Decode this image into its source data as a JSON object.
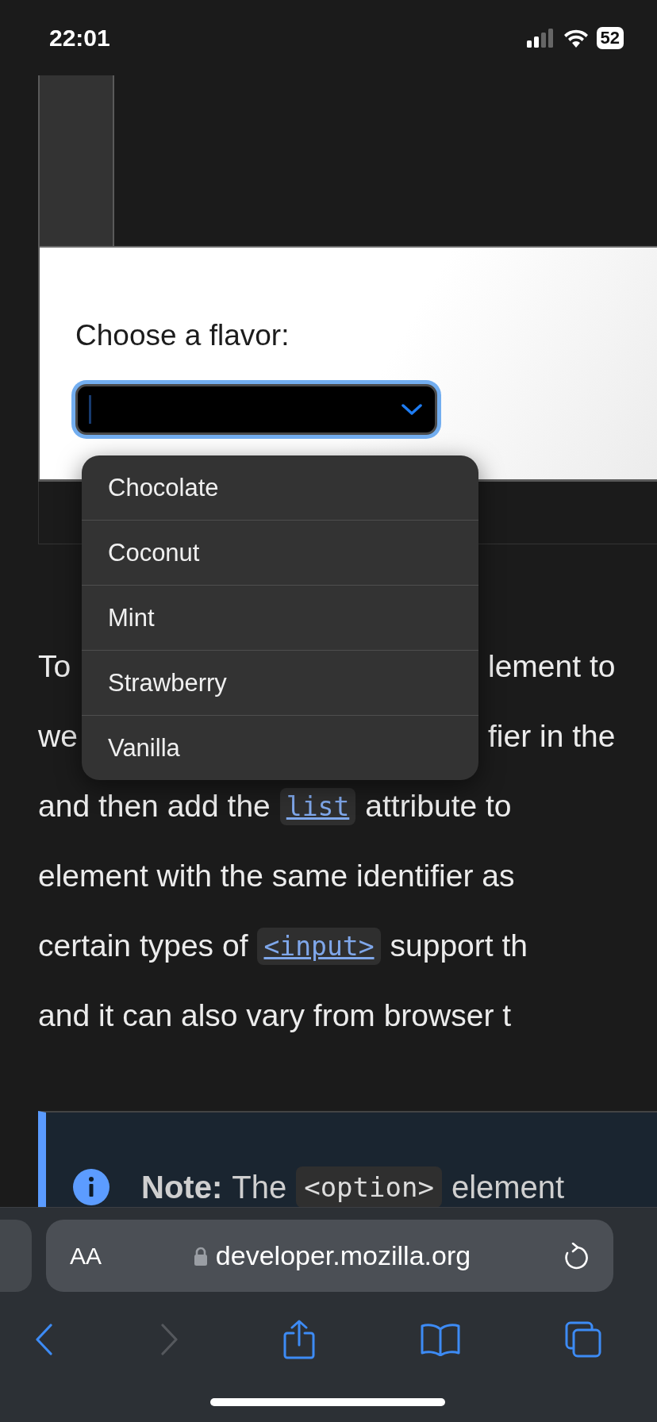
{
  "status_bar": {
    "time": "22:01",
    "battery": "52"
  },
  "demo": {
    "label": "Choose a flavor:",
    "focused": true,
    "open": true,
    "options": [
      {
        "label": "Chocolate"
      },
      {
        "label": "Coconut"
      },
      {
        "label": "Mint"
      },
      {
        "label": "Strawberry"
      },
      {
        "label": "Vanilla"
      }
    ]
  },
  "paragraph": [
    {
      "kind": "split",
      "left": "To",
      "right": "lement to"
    },
    {
      "kind": "split",
      "left": "we",
      "right": "fier in the"
    },
    {
      "kind": "full",
      "segments": [
        {
          "kind": "text",
          "text": "and then add the"
        },
        {
          "kind": "code",
          "text": "list",
          "link": true
        },
        {
          "kind": "text",
          "text": "attribute to"
        }
      ]
    },
    {
      "kind": "full",
      "segments": [
        {
          "kind": "text",
          "text": "element with the same identifier as"
        }
      ]
    },
    {
      "kind": "full",
      "segments": [
        {
          "kind": "text",
          "text": "certain types of"
        },
        {
          "kind": "code",
          "text": "<input>",
          "link": true
        },
        {
          "kind": "text",
          "text": "support th"
        }
      ]
    },
    {
      "kind": "full",
      "segments": [
        {
          "kind": "text",
          "text": "and it can also vary from browser t"
        }
      ]
    }
  ],
  "note": {
    "label": "Note:",
    "text": "The",
    "code": "<option>",
    "text_after": "element"
  },
  "browser": {
    "text_size_button": "AA",
    "url": "developer.mozilla.org",
    "secure": true,
    "back_enabled": true,
    "forward_enabled": false
  }
}
